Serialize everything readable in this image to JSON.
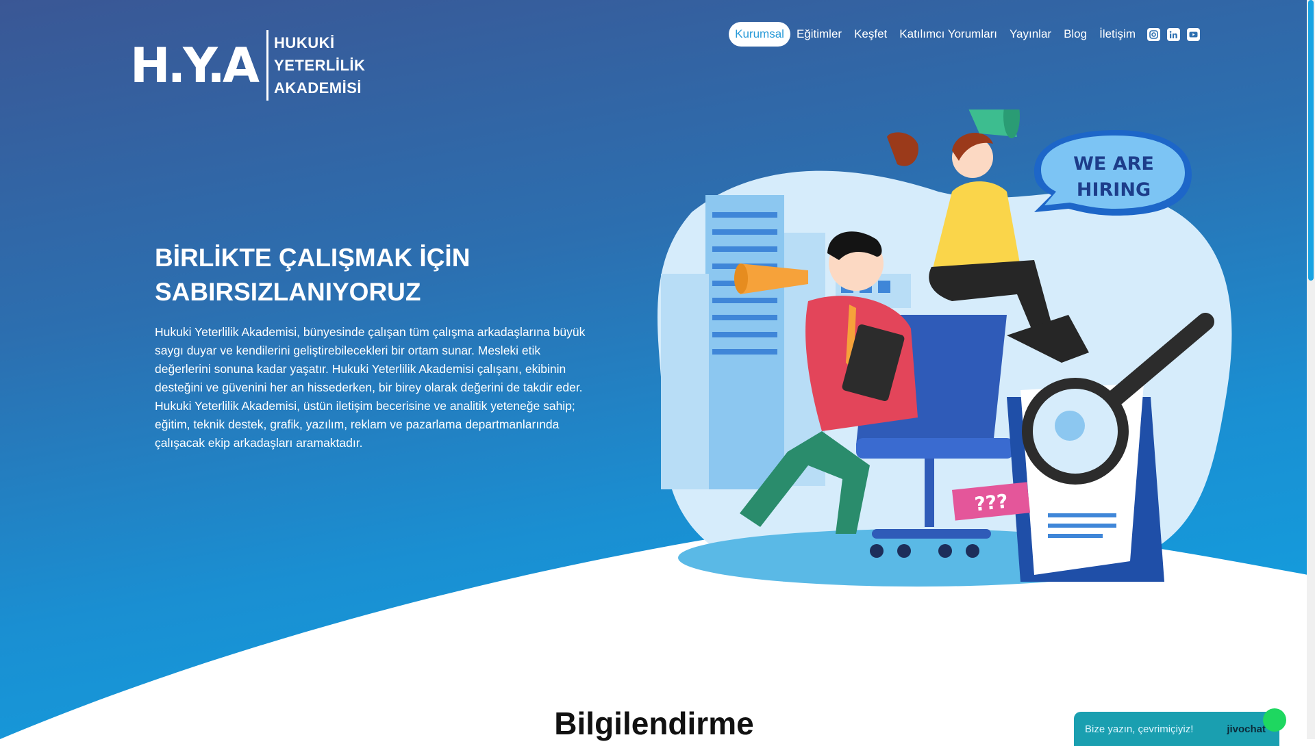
{
  "brand": {
    "mark": "H.Y.A",
    "lines": [
      "HUKUKİ",
      "YETERLİLİK",
      "AKADEMİSİ"
    ]
  },
  "nav": {
    "items": [
      "Kurumsal",
      "Eğitimler",
      "Keşfet",
      "Katılımcı Yorumları",
      "Yayınlar",
      "Blog",
      "İletişim"
    ],
    "active": "Kurumsal",
    "social_icons": [
      "instagram-icon",
      "linkedin-icon",
      "youtube-icon"
    ]
  },
  "hero": {
    "title_line1": "BİRLİKTE ÇALIŞMAK İÇİN",
    "title_line2": "SABIRSIZLANIYORUZ",
    "body": "Hukuki Yeterlilik Akademisi, bünyesinde çalışan tüm çalışma arkadaşlarına büyük saygı duyar ve kendilerini geliştirebilecekleri bir ortam sunar. Mesleki etik değerlerini sonuna kadar yaşatır. Hukuki Yeterlilik Akademisi çalışanı, ekibinin desteğini ve güvenini her an hissederken, bir birey olarak değerini de takdir eder. Hukuki Yeterlilik Akademisi, üstün iletişim becerisine ve analitik yeteneğe sahip; eğitim, teknik destek, grafik, yazılım, reklam ve pazarlama departmanlarında çalışacak ekip arkadaşları aramaktadır."
  },
  "illustration": {
    "bubble_line1": "WE ARE",
    "bubble_line2": "HIRING",
    "sign": "???"
  },
  "section": {
    "title": "Bilgilendirme"
  },
  "chat": {
    "text": "Bize yazın, çevrimiçiyiz!",
    "brand": "jivochat"
  },
  "colors": {
    "gradient_top": "#3a5795",
    "gradient_bottom": "#10a5e4",
    "accent": "#2a9bd8"
  }
}
